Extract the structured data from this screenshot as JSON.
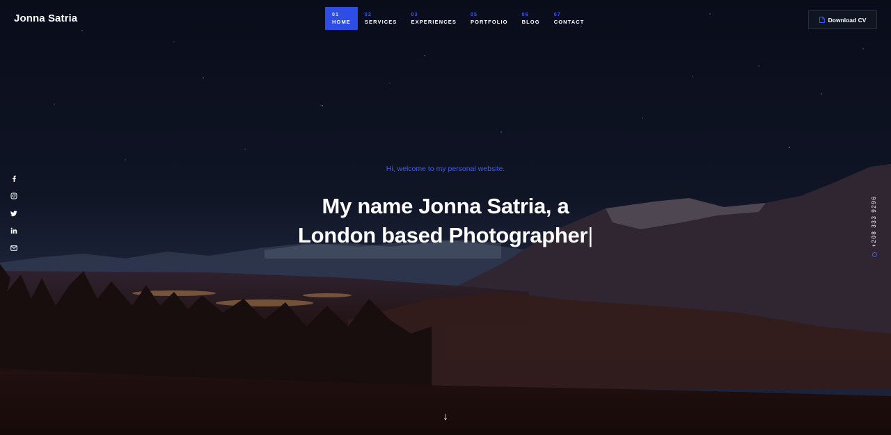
{
  "brand": {
    "name": "Jonna Satria"
  },
  "nav": {
    "items": [
      {
        "num": "01",
        "label": "HOME"
      },
      {
        "num": "02",
        "label": "SERVICES"
      },
      {
        "num": "03",
        "label": "EXPERIENCES"
      },
      {
        "num": "05",
        "label": "PORTFOLIO"
      },
      {
        "num": "06",
        "label": "BLOG"
      },
      {
        "num": "07",
        "label": "CONTACT"
      }
    ],
    "active_index": 0
  },
  "header": {
    "download_label": "Download CV",
    "download_icon": "document-icon"
  },
  "social": {
    "icons": [
      "facebook-icon",
      "instagram-icon",
      "twitter-icon",
      "linkedin-icon",
      "mail-icon"
    ]
  },
  "contact": {
    "phone": "+208 333 9296"
  },
  "hero": {
    "welcome": "Hi, welcome to my personal website.",
    "headline_line1": "My name Jonna Satria, a",
    "headline_line2": "London based Photographer",
    "cursor": "|",
    "scroll_arrow": "↓"
  },
  "colors": {
    "accent": "#2e4de5",
    "accent_text": "#3b5cf0",
    "sky_top": "#0d1120",
    "sky_bottom": "#1c2238"
  }
}
